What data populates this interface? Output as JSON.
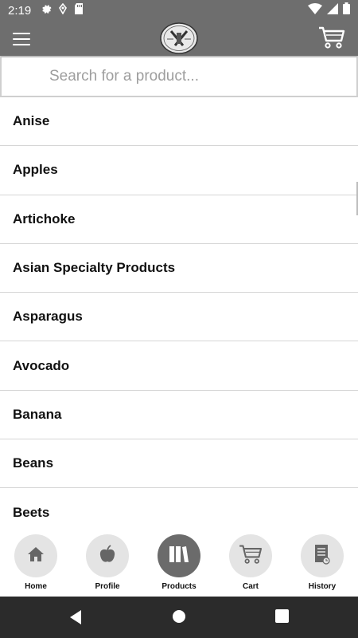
{
  "status_bar": {
    "time": "2:19"
  },
  "search": {
    "placeholder": "Search for a product..."
  },
  "products": [
    "Anise",
    "Apples",
    "Artichoke",
    "Asian Specialty Products",
    "Asparagus",
    "Avocado",
    "Banana",
    "Beans",
    "Beets"
  ],
  "bottom_nav": {
    "home": "Home",
    "profile": "Profile",
    "products": "Products",
    "cart": "Cart",
    "history": "History",
    "active": "Products"
  },
  "colors": {
    "app_bar": "#6e6e6e",
    "nav_inactive": "#e4e4e4",
    "nav_active": "#6b6b6b",
    "system_nav": "#2b2b2b"
  },
  "icons": [
    "gear-icon",
    "location-icon",
    "sd-card-icon",
    "wifi-icon",
    "signal-icon",
    "battery-icon",
    "menu-icon",
    "logo",
    "cart-icon",
    "home-icon",
    "apple-icon",
    "books-icon",
    "cart-icon",
    "history-icon",
    "back-icon",
    "home-circle-icon",
    "recents-icon"
  ]
}
